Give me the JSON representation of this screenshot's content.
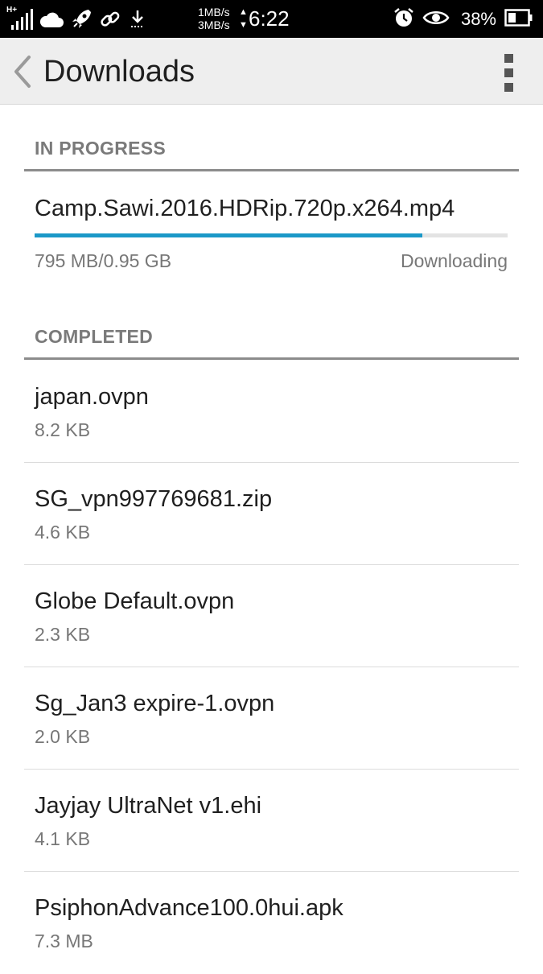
{
  "status_bar": {
    "network_type": "H+",
    "upload_speed": "1MB/s",
    "download_speed": "3MB/s",
    "time": "6:22",
    "battery_percent": "38%"
  },
  "app_bar": {
    "title": "Downloads"
  },
  "in_progress": {
    "header": "IN PROGRESS",
    "file_name": "Camp.Sawi.2016.HDRip.720p.x264.mp4",
    "progress_text": "795 MB/0.95 GB",
    "status": "Downloading",
    "progress_fraction": 0.82
  },
  "completed": {
    "header": "COMPLETED",
    "items": [
      {
        "name": "japan.ovpn",
        "size": "8.2 KB"
      },
      {
        "name": "SG_vpn997769681.zip",
        "size": "4.6 KB"
      },
      {
        "name": "Globe Default.ovpn",
        "size": "2.3 KB"
      },
      {
        "name": "Sg_Jan3 expire-1.ovpn",
        "size": "2.0 KB"
      },
      {
        "name": "Jayjay UltraNet v1.ehi",
        "size": "4.1 KB"
      },
      {
        "name": "PsiphonAdvance100.0hui.apk",
        "size": "7.3 MB"
      }
    ]
  },
  "colors": {
    "accent": "#1b98c8",
    "app_bar_bg": "#eeeeee",
    "status_bar_bg": "#000000"
  },
  "icons": {
    "status_left": [
      "signal-icon",
      "cloud-icon",
      "rocket-icon",
      "link-icon",
      "download-notification-icon"
    ],
    "status_right": [
      "alarm-icon",
      "eye-icon",
      "battery-icon"
    ],
    "app_bar": [
      "back-chevron-icon",
      "overflow-menu-icon"
    ]
  }
}
